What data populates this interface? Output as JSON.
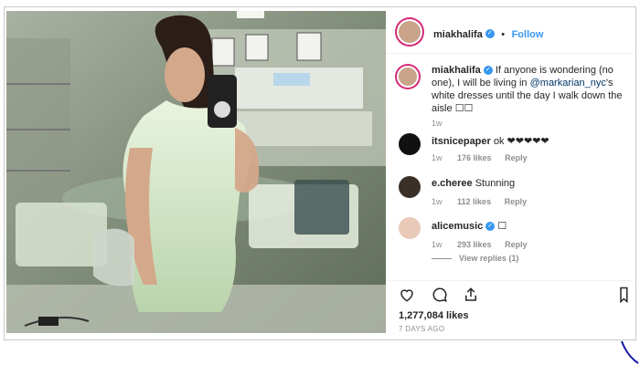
{
  "header": {
    "username": "miakhalifa",
    "follow_label": "Follow",
    "dot": "•"
  },
  "caption": {
    "username": "miakhalifa",
    "text_1": "If anyone is wondering (no one), I will be living in ",
    "mention": "@markarian_nyc",
    "text_2": "'s white dresses until the day I walk down the aisle",
    "tail_glyph": "☐☐",
    "time": "1w"
  },
  "comments": [
    {
      "username": "itsnicepaper",
      "text": "ok ❤❤❤❤❤",
      "time": "1w",
      "likes": "176 likes",
      "reply": "Reply"
    },
    {
      "username": "e.cheree",
      "text": "Stunning",
      "time": "1w",
      "likes": "112 likes",
      "reply": "Reply"
    },
    {
      "username": "alicemusic",
      "text": "☐",
      "time": "1w",
      "likes": "293 likes",
      "reply": "Reply",
      "view_replies": "View replies (1)"
    }
  ],
  "footer": {
    "likes": "1,277,084 likes",
    "posted": "7 DAYS AGO"
  },
  "colors": {
    "accent": "#3897f0",
    "text": "#262626",
    "muted": "#8e8e8e",
    "border": "#efefef"
  }
}
